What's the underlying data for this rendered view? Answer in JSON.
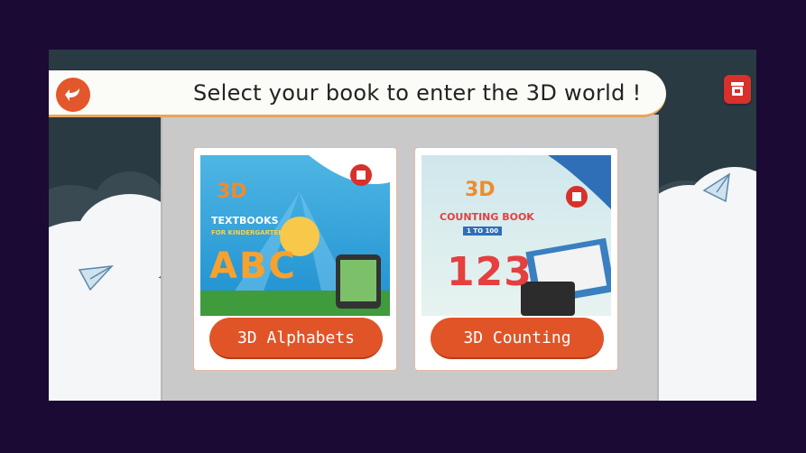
{
  "header": {
    "title": "Select your book to enter the 3D world !"
  },
  "books": [
    {
      "button_label": "3D Alphabets",
      "cover": {
        "line1": "3D",
        "line2": "TEXTBOOKS",
        "line3": "FOR KINDERGARTEN",
        "big": "ABC"
      }
    },
    {
      "button_label": "3D Counting",
      "cover": {
        "line1": "3D",
        "line2": "COUNTING BOOK",
        "line3": "1 TO 100",
        "big": "123"
      }
    }
  ],
  "colors": {
    "accent": "#e15428",
    "background": "#2a3a43",
    "panel": "#c9c9c9"
  },
  "icons": {
    "back": "back-arrow-icon",
    "cart": "store-icon",
    "plane": "paper-plane-icon"
  }
}
